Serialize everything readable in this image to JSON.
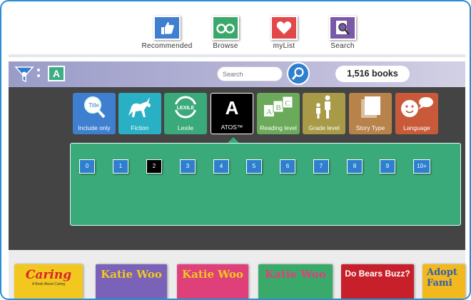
{
  "nav": [
    {
      "label": "Recommended",
      "icon": "thumbs-up-icon",
      "color": "#3f7fcf"
    },
    {
      "label": "Browse",
      "icon": "binoculars-icon",
      "color": "#3aa86a"
    },
    {
      "label": "myList",
      "icon": "heart-icon",
      "color": "#e2474a"
    },
    {
      "label": "Search",
      "icon": "magnifier-book-icon",
      "color": "#7a5aa8"
    }
  ],
  "filterbar": {
    "active_filter": "A",
    "search_placeholder": "Search",
    "count": "1,516 books"
  },
  "categories": [
    {
      "label": "Include only",
      "icon": "title-search-icon",
      "color": "#3f7fcf",
      "active": false
    },
    {
      "label": "Fiction",
      "icon": "unicorn-icon",
      "color": "#2ab0c4",
      "active": false
    },
    {
      "label": "Lexile",
      "icon": "lexile-icon",
      "color": "#3aaa7a",
      "active": false
    },
    {
      "label": "ATOS™",
      "icon": "letter-a-icon",
      "color": "#000000",
      "active": true,
      "glyph": "A"
    },
    {
      "label": "Reading level",
      "icon": "abc-blocks-icon",
      "color": "#6aaa5a",
      "active": false
    },
    {
      "label": "Grade level",
      "icon": "parent-child-icon",
      "color": "#a89a46",
      "active": false
    },
    {
      "label": "Story Type",
      "icon": "pages-icon",
      "color": "#b8834a",
      "active": false
    },
    {
      "label": "Language",
      "icon": "speech-face-icon",
      "color": "#c85a3a",
      "active": false
    }
  ],
  "lexile_text": "LEXILE",
  "abc": [
    "A",
    "B",
    "C"
  ],
  "levels": [
    "0",
    "1",
    "2",
    "3",
    "4",
    "5",
    "6",
    "7",
    "8",
    "9",
    "10+"
  ],
  "selected_level": "2",
  "books": [
    {
      "title": "Caring",
      "subtitle": "A Book About Caring",
      "color": "#f2c81e"
    },
    {
      "title": "Katie Woo",
      "color": "#7a62b8"
    },
    {
      "title": "Katie Woo",
      "color": "#e0407a"
    },
    {
      "title": "Katie Woo",
      "color": "#3aaa6a"
    },
    {
      "title": "Do Bears Buzz?",
      "color": "#c8202a"
    },
    {
      "title": "Adopt Fami",
      "color": "#f2b81e"
    }
  ]
}
